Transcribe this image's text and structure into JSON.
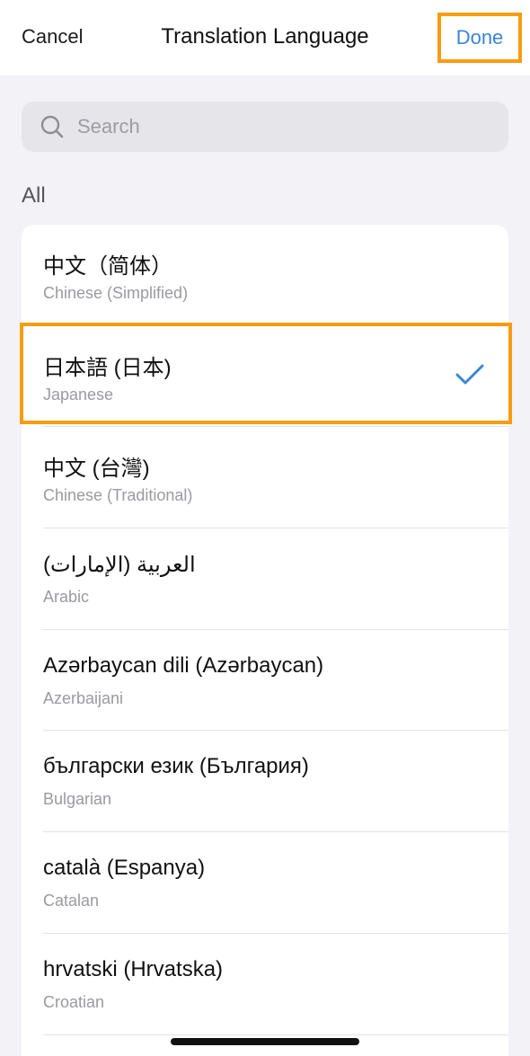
{
  "header": {
    "cancel_label": "Cancel",
    "title": "Translation Language",
    "done_label": "Done"
  },
  "search": {
    "placeholder": "Search",
    "value": ""
  },
  "section_label": "All",
  "languages": [
    {
      "name": "中文（简体）",
      "english": "Chinese (Simplified)",
      "selected": false
    },
    {
      "name": "日本語 (日本)",
      "english": "Japanese",
      "selected": true
    },
    {
      "name": "中文 (台灣)",
      "english": "Chinese (Traditional)",
      "selected": false
    },
    {
      "name": "العربية (الإمارات)",
      "english": "Arabic",
      "selected": false
    },
    {
      "name": "Azərbaycan dili (Azərbaycan)",
      "english": "Azerbaijani",
      "selected": false
    },
    {
      "name": "български език (България)",
      "english": "Bulgarian",
      "selected": false
    },
    {
      "name": "català (Espanya)",
      "english": "Catalan",
      "selected": false
    },
    {
      "name": "hrvatski (Hrvatska)",
      "english": "Croatian",
      "selected": false
    }
  ],
  "colors": {
    "accent": "#3a86d4",
    "highlight": "#f89c10"
  },
  "icons": {
    "search": "search-icon",
    "check": "checkmark-icon"
  }
}
